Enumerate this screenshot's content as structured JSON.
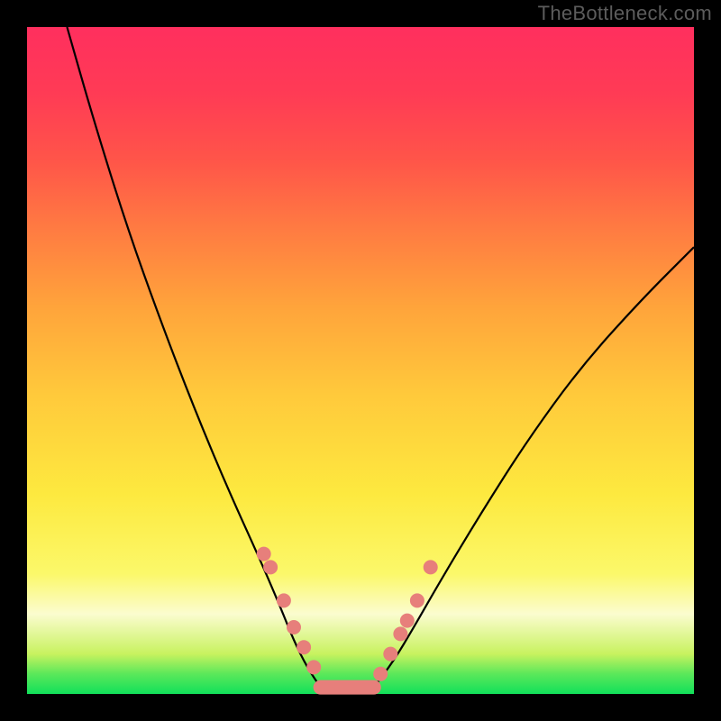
{
  "watermark": "TheBottleneck.com",
  "colors": {
    "dot": "#e77f7b",
    "curve": "#000000",
    "frame": "#000000"
  },
  "chart_data": {
    "type": "line",
    "title": "",
    "xlabel": "",
    "ylabel": "",
    "xlim": [
      0,
      100
    ],
    "ylim": [
      0,
      100
    ],
    "series": [
      {
        "name": "left-curve",
        "x": [
          6,
          10,
          15,
          20,
          25,
          30,
          35,
          38,
          40,
          42,
          44
        ],
        "y": [
          100,
          86,
          70,
          56,
          43,
          31,
          20,
          13,
          8,
          4,
          1
        ]
      },
      {
        "name": "right-curve",
        "x": [
          52,
          55,
          58,
          62,
          68,
          75,
          83,
          92,
          100
        ],
        "y": [
          1,
          5,
          10,
          17,
          27,
          38,
          49,
          59,
          67
        ]
      },
      {
        "name": "highlight-dots",
        "x": [
          35.5,
          36.5,
          38.5,
          40.0,
          41.5,
          43.0,
          53.0,
          54.5,
          56.0,
          57.0,
          58.5,
          60.5
        ],
        "y": [
          21,
          19,
          14,
          10,
          7,
          4,
          3,
          6,
          9,
          11,
          14,
          19
        ]
      },
      {
        "name": "plateau",
        "x": [
          44,
          52
        ],
        "y": [
          1,
          1
        ]
      }
    ]
  }
}
